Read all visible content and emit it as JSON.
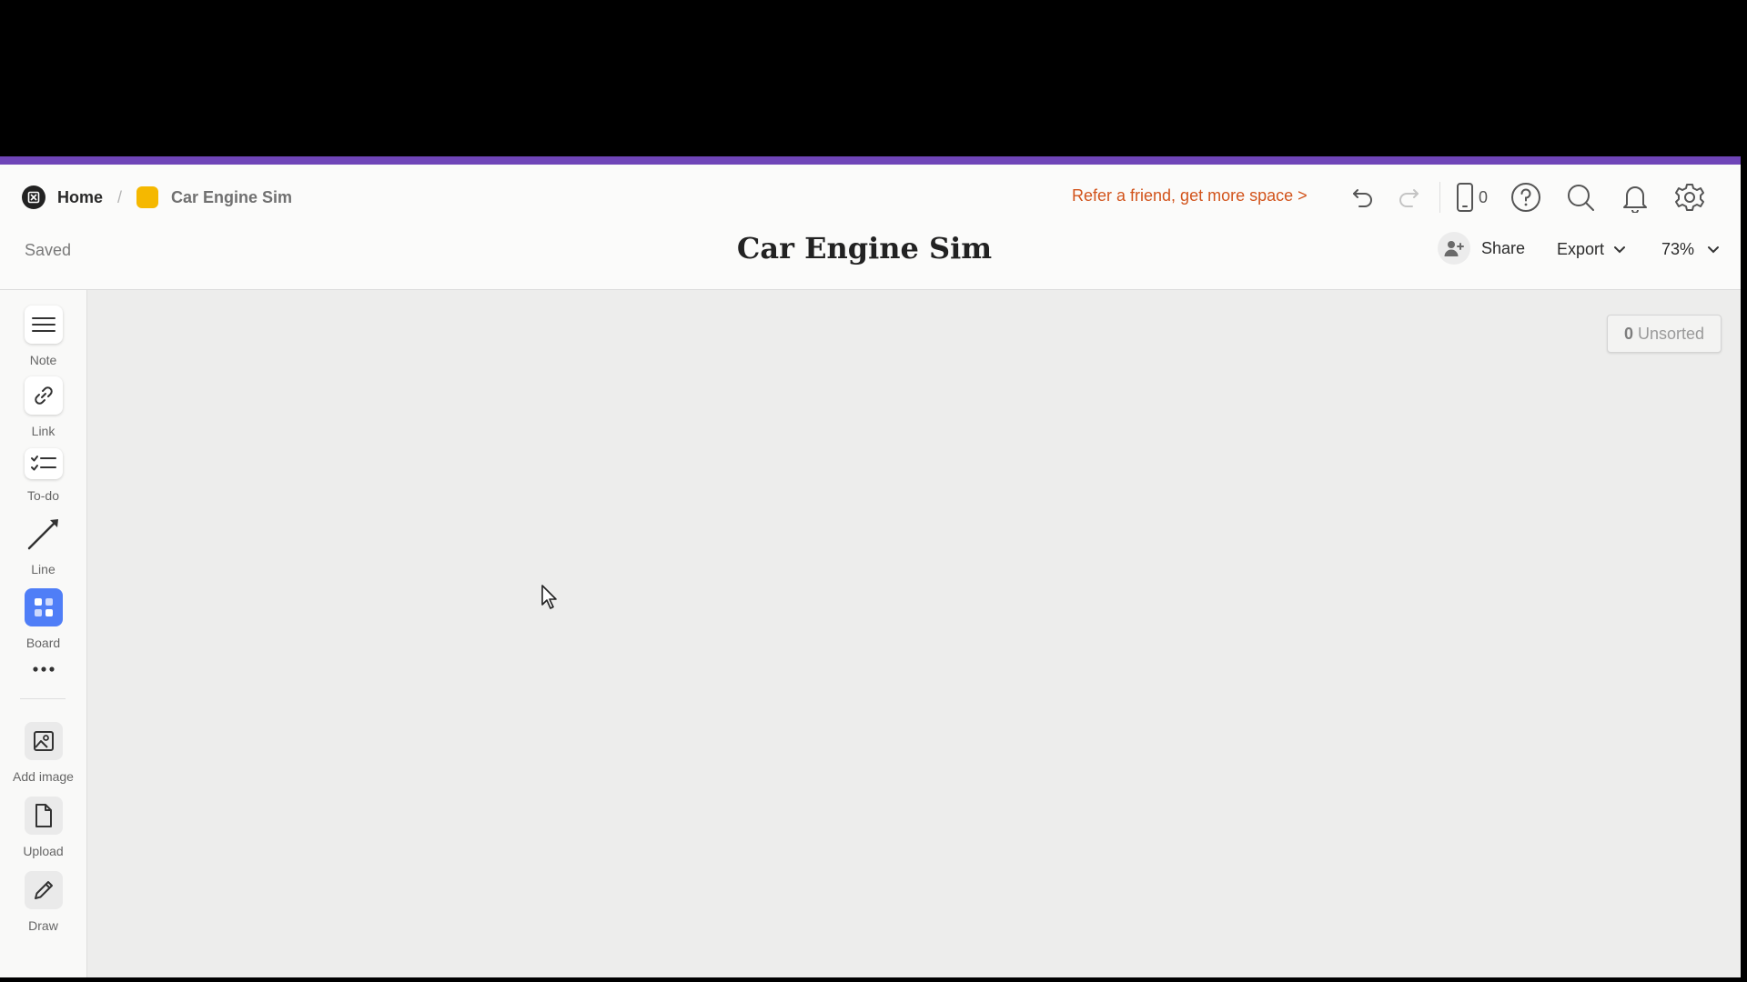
{
  "breadcrumb": {
    "home": "Home",
    "separator": "/",
    "board": "Car Engine Sim",
    "board_color": "#f5b800"
  },
  "header": {
    "refer_text": "Refer a friend, get more space >",
    "device_count": "0",
    "saved_status": "Saved",
    "title": "Car Engine Sim",
    "share_label": "Share",
    "export_label": "Export",
    "zoom_label": "73%",
    "accent_color": "#6f45b8",
    "refer_color": "#d2541c"
  },
  "sidebar": {
    "tools": [
      {
        "label": "Note",
        "icon": "note-icon"
      },
      {
        "label": "Link",
        "icon": "link-icon"
      },
      {
        "label": "To-do",
        "icon": "todo-icon"
      },
      {
        "label": "Line",
        "icon": "line-icon"
      },
      {
        "label": "Board",
        "icon": "board-icon"
      }
    ],
    "uploads": [
      {
        "label": "Add image",
        "icon": "image-icon"
      },
      {
        "label": "Upload",
        "icon": "file-icon"
      },
      {
        "label": "Draw",
        "icon": "pencil-icon"
      }
    ]
  },
  "canvas": {
    "unsorted_count": "0",
    "unsorted_label": "Unsorted"
  }
}
